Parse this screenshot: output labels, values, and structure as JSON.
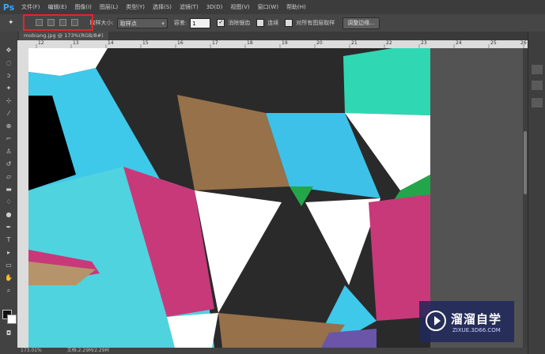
{
  "menubar": {
    "logo": "Ps",
    "items": [
      "文件(F)",
      "编辑(E)",
      "图像(I)",
      "图层(L)",
      "类型(Y)",
      "选择(S)",
      "滤镜(T)",
      "3D(D)",
      "视图(V)",
      "窗口(W)",
      "帮助(H)"
    ]
  },
  "options": {
    "sample_size_label": "取样大小:",
    "sample_size_value": "取样点",
    "tolerance_label": "容差:",
    "tolerance_value": "1",
    "antialias_label": "消除锯齿",
    "contiguous_label": "连续",
    "sample_all_layers_label": "对所有图层取样",
    "refine_edge_label": "调整边缘..."
  },
  "document": {
    "tab_label": "mobiang.jpg @ 173%(RGB/8#)"
  },
  "ruler": {
    "h_numbers": [
      "12",
      "13",
      "14",
      "15",
      "16",
      "17",
      "18",
      "19",
      "20",
      "21",
      "22",
      "23",
      "24",
      "25",
      "26"
    ]
  },
  "status": {
    "zoom": "173.01%",
    "doc_info": "文档:2.29M/2.29M"
  },
  "watermark": {
    "title": "溜溜自学",
    "subtitle": "ZIXUE.3D66.COM"
  },
  "colors": {
    "selection_highlight": "#e8232a",
    "ps_blue": "#31a8ff"
  }
}
